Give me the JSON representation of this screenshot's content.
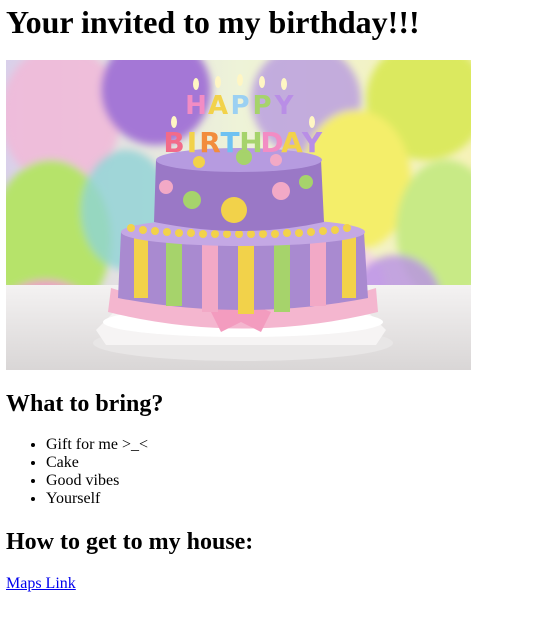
{
  "page": {
    "title": "Your invited to my birthday!!!"
  },
  "hero_image": {
    "subject": "birthday cake with balloons",
    "banner_lines": [
      "HAPPY",
      "BIRTHDAY"
    ]
  },
  "bring_section": {
    "heading": "What to bring?",
    "items": [
      "Gift for me >_<",
      "Cake",
      "Good vibes",
      "Yourself"
    ]
  },
  "directions_section": {
    "heading": "How to get to my house:",
    "link_label": "Maps Link"
  },
  "colors": {
    "link": "#0000ee",
    "text": "#000000",
    "cake_purple": "#a98ad0",
    "cake_pink": "#f2a9c6",
    "cake_yellow": "#f2d24a",
    "cake_green": "#a6d36b"
  }
}
